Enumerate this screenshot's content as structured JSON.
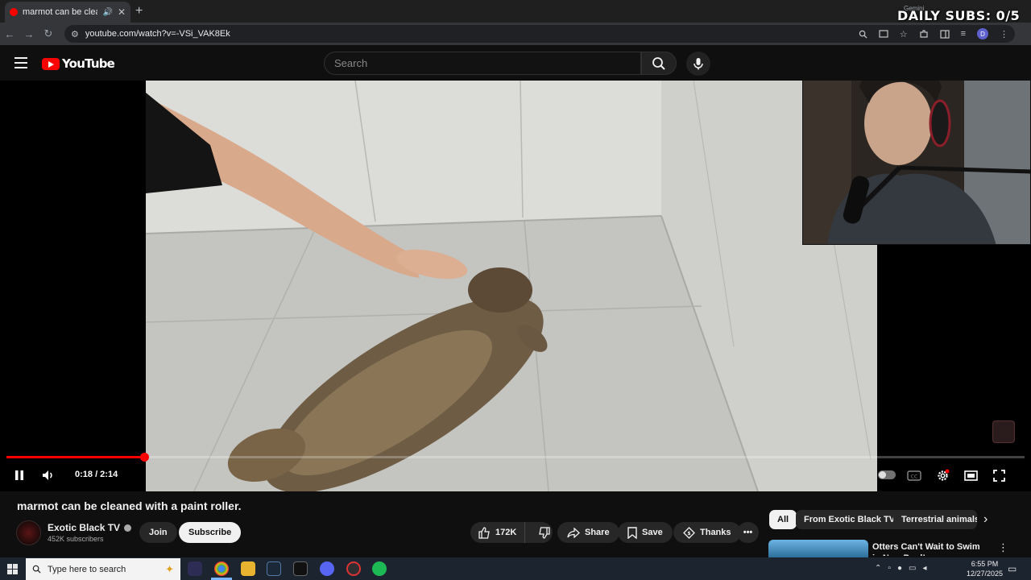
{
  "browser": {
    "tab": {
      "title": "marmot can be cleaned wit",
      "close": "✕"
    },
    "new_tab": "+",
    "url": "youtube.com/watch?v=-VSi_VAK8Ek",
    "gemini_label": "Gemini",
    "profile_initial": "D"
  },
  "stream_overlay": {
    "daily_subs": "DAILY SUBS: 0/5"
  },
  "youtube": {
    "logo_text": "YouTube",
    "search": {
      "placeholder": "Search",
      "value": ""
    }
  },
  "player": {
    "current_time": "0:18",
    "duration": "2:14",
    "time_display": "0:18 / 2:14",
    "progress_fraction": 0.135,
    "state": "playing"
  },
  "video": {
    "title": "marmot can be cleaned with a paint roller.",
    "channel": "Exotic Black TV",
    "subscribers": "452K subscribers",
    "join_label": "Join",
    "subscribe_label": "Subscribe",
    "likes": "172K",
    "share_label": "Share",
    "save_label": "Save",
    "thanks_label": "Thanks"
  },
  "sidebar": {
    "chips": [
      "All",
      "From Exotic Black TV",
      "Terrestrial animals"
    ],
    "recommendation": {
      "title": "Otters Can't Wait to Swim in New Pool!"
    }
  },
  "taskbar": {
    "search_placeholder": "Type here to search",
    "time": "6:55 PM",
    "date": "12/27/2025"
  },
  "colors": {
    "accent": "#ff0000",
    "background": "#0f0f0f",
    "pill": "#272727",
    "taskbar": "#1c2430"
  }
}
